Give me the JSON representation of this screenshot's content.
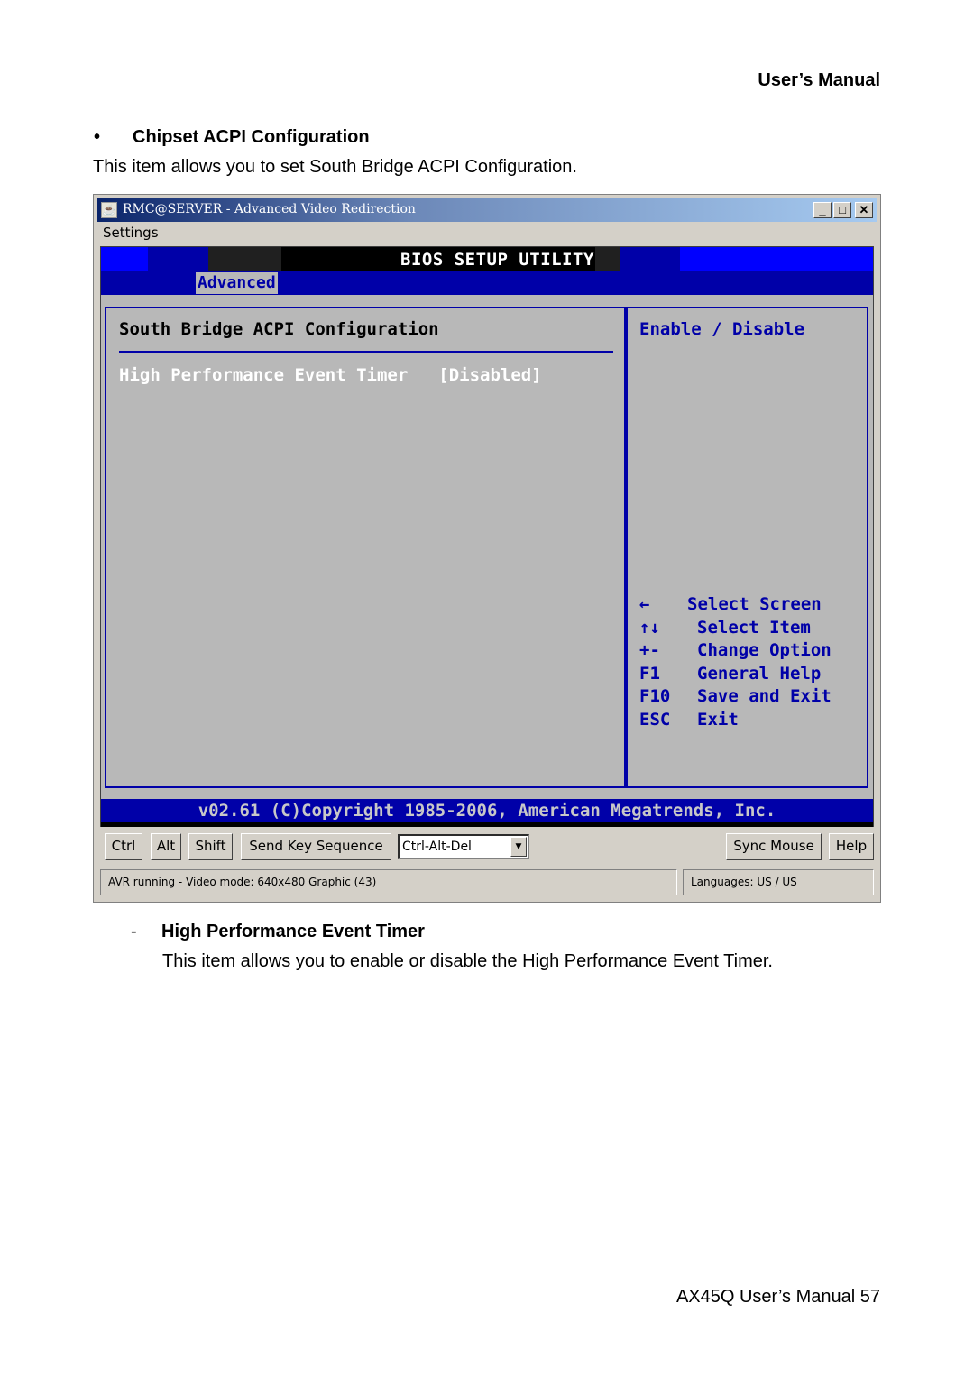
{
  "page": {
    "header": "User’s  Manual",
    "section_bullet": "•",
    "section_title": "Chipset ACPI Configuration",
    "section_desc": "This item allows you to set South Bridge ACPI Configuration.",
    "sub_dash": "-",
    "sub_title": "High Performance Event Timer",
    "sub_desc": "This item allows you to enable or disable the High Performance Event Timer.",
    "footer": "AX45Q  User’s  Manual  57"
  },
  "window": {
    "app_icon": "java-coffee-icon",
    "app_icon_glyph": "☕",
    "title": "RMC@SERVER - Advanced Video Redirection",
    "minimize": "_",
    "maximize": "□",
    "close": "✕",
    "menu": [
      "Settings"
    ]
  },
  "bios": {
    "title": "BIOS SETUP UTILITY",
    "active_tab": "Advanced",
    "panel_heading": "South Bridge ACPI Configuration",
    "setting": {
      "label": "High Performance Event Timer",
      "value": "[Disabled]"
    },
    "help": "Enable / Disable",
    "keys": [
      {
        "key": "←",
        "action": "Select Screen"
      },
      {
        "key": "↑↓",
        "action": "Select Item"
      },
      {
        "key": "+-",
        "action": "Change Option"
      },
      {
        "key": "F1",
        "action": "General Help"
      },
      {
        "key": "F10",
        "action": "Save and Exit"
      },
      {
        "key": "ESC",
        "action": "Exit"
      }
    ],
    "copyright": "v02.61 (C)Copyright 1985-2006, American Megatrends, Inc.",
    "colors": {
      "blue": "#0000a8",
      "gray": "#b8b8b8",
      "bright_blue": "#0000ff"
    }
  },
  "controls": {
    "ctrl": "Ctrl",
    "alt": "Alt",
    "shift": "Shift",
    "send_key_sequence": "Send Key Sequence",
    "key_sequence_selected": "Ctrl-Alt-Del",
    "dropdown_arrow": "▼",
    "sync_mouse": "Sync Mouse",
    "help": "Help"
  },
  "status": {
    "left": "AVR running - Video mode: 640x480 Graphic (43)",
    "right": "Languages: US / US"
  }
}
